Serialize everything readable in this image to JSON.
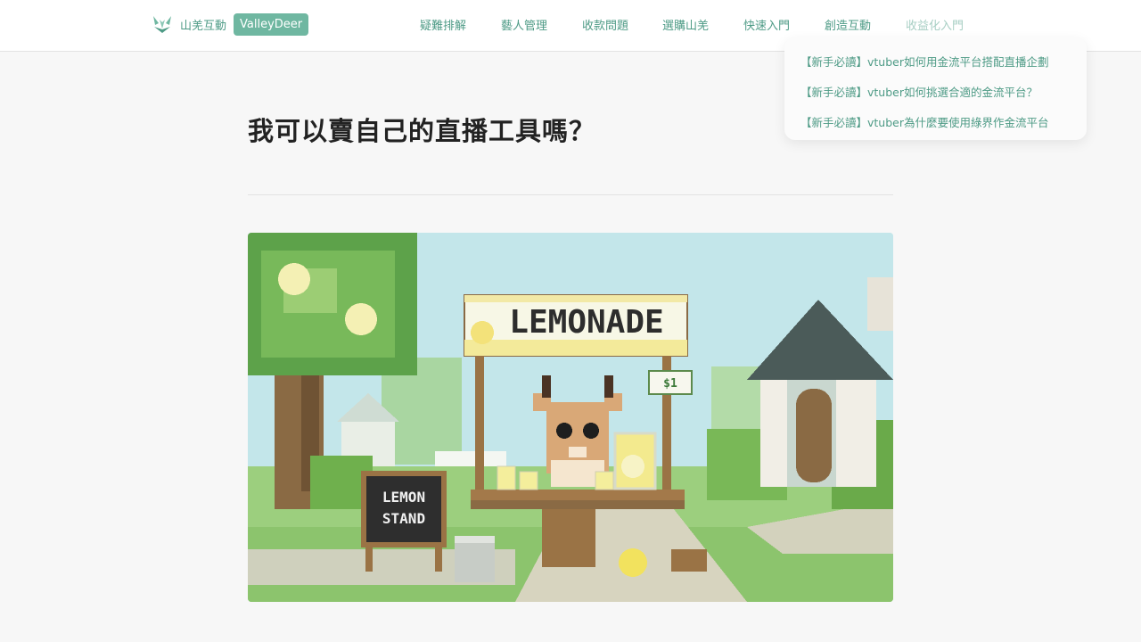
{
  "brand": {
    "name": "山羌互動",
    "badge": "ValleyDeer"
  },
  "nav": {
    "items": [
      "疑難排解",
      "藝人管理",
      "收款問題",
      "選購山羌",
      "快速入門",
      "創造互動",
      "收益化入門"
    ]
  },
  "dropdown": {
    "items": [
      "【新手必讀】vtuber如何用金流平台搭配直播企劃",
      "【新手必讀】vtuber如何挑選合適的金流平台？",
      "【新手必讀】vtuber為什麼要使用綠界作金流平台"
    ]
  },
  "page": {
    "title": "我可以賣自己的直播工具嗎？"
  },
  "hero": {
    "sign": "LEMONADE",
    "board_line1": "LEMON",
    "board_line2": "STAND",
    "price": "$1"
  },
  "colors": {
    "accent": "#6fb7a1",
    "link": "#4e9b86"
  }
}
